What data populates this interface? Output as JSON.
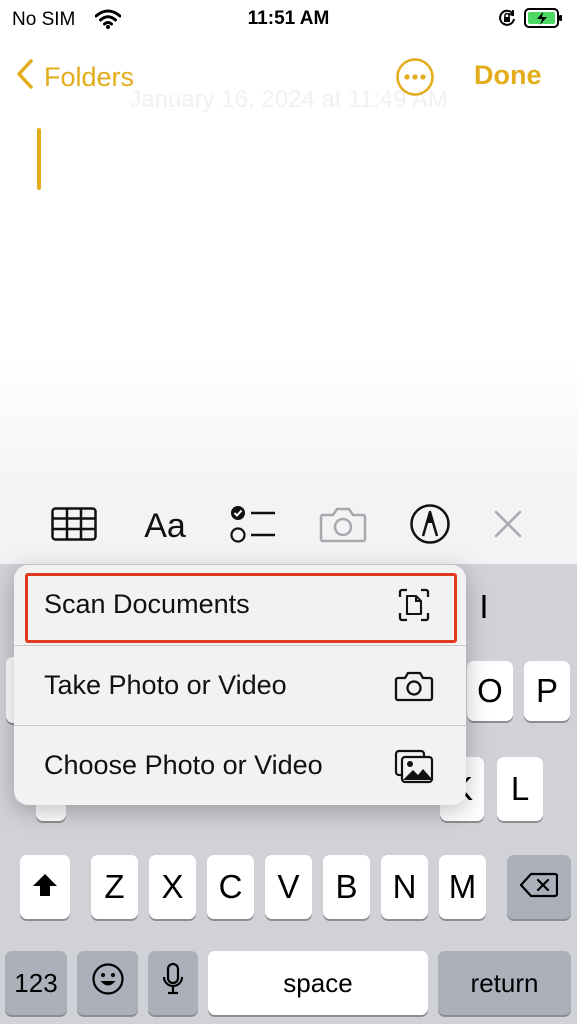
{
  "status_bar": {
    "carrier": "No SIM",
    "time": "11:51 AM"
  },
  "nav": {
    "back_label": "Folders",
    "done_label": "Done",
    "ghost_date": "January 16, 2024 at 11:49 AM"
  },
  "toolbar": {
    "format_label": "Aa"
  },
  "menu": {
    "items": [
      {
        "label": "Scan Documents",
        "icon": "doc-scan-icon"
      },
      {
        "label": "Take Photo or Video",
        "icon": "camera-icon"
      },
      {
        "label": "Choose Photo or Video",
        "icon": "photo-library-icon"
      }
    ]
  },
  "keyboard": {
    "row1_visible": [
      "I",
      "O",
      "P"
    ],
    "row2_visible": [
      "K",
      "L"
    ],
    "row3": [
      "Z",
      "X",
      "C",
      "V",
      "B",
      "N",
      "M"
    ],
    "numbers_label": "123",
    "space_label": "space",
    "return_label": "return"
  },
  "colors": {
    "accent": "#e3ac1b",
    "highlight": "#e03a21"
  }
}
